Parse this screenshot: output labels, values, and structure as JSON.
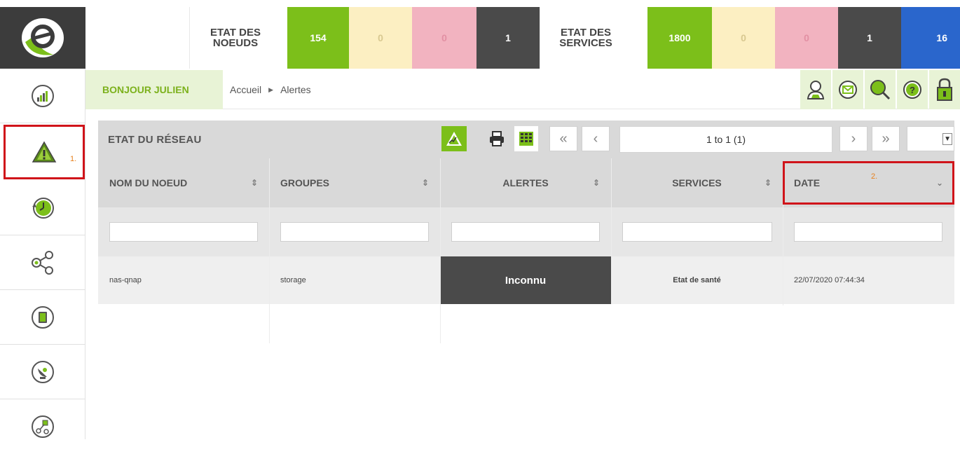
{
  "topbar": {
    "nodes_label_line1": "ETAT DES",
    "nodes_label_line2": "NOEUDS",
    "nodes_ok": "154",
    "nodes_warning": "0",
    "nodes_critical": "0",
    "nodes_unknown": "1",
    "services_label_line1": "ETAT DES",
    "services_label_line2": "SERVICES",
    "services_ok": "1800",
    "services_warning": "0",
    "services_critical": "0",
    "services_unknown": "1",
    "services_extra": "16"
  },
  "sidebar": {
    "items": [
      {
        "icon": "dashboard-chart-icon"
      },
      {
        "icon": "alert-triangle-icon",
        "annotation": "1."
      },
      {
        "icon": "history-clock-icon"
      },
      {
        "icon": "share-network-icon"
      },
      {
        "icon": "book-icon"
      },
      {
        "icon": "satellite-dish-icon"
      },
      {
        "icon": "topology-icon"
      }
    ]
  },
  "crumbbar": {
    "greeting": "BONJOUR JULIEN",
    "crumb_home": "Accueil",
    "crumb_current": "Alertes",
    "tools": [
      "user-icon",
      "mail-icon",
      "search-icon",
      "help-icon",
      "lock-icon"
    ]
  },
  "panel": {
    "title": "ETAT DU RÉSEAU",
    "pager": "1 to 1 (1)",
    "columns": [
      {
        "label": "NOM DU NOEUD",
        "sort": "⇕"
      },
      {
        "label": "GROUPES",
        "sort": "⇕"
      },
      {
        "label": "ALERTES",
        "sort": "⇕"
      },
      {
        "label": "SERVICES",
        "sort": "⇕"
      },
      {
        "label": "DATE",
        "sort": "⌄",
        "annotation": "2."
      }
    ],
    "rows": [
      {
        "node": "nas-qnap",
        "group": "storage",
        "alert": "Inconnu",
        "service": "Etat de santé",
        "date": "22/07/2020 07:44:34"
      }
    ]
  },
  "colors": {
    "ok": "#7cbf1a",
    "warning": "#fcefc2",
    "critical": "#f2b3c0",
    "unknown": "#4a4a4a",
    "extra": "#2a66cc",
    "highlight_red": "#d0141a"
  }
}
